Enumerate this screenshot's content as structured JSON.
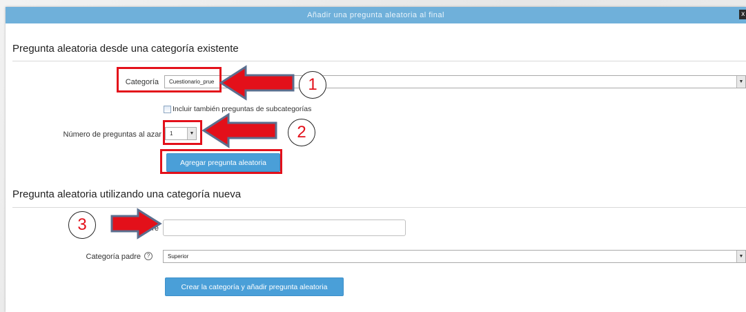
{
  "dialog": {
    "title": "Añadir una pregunta aleatoria al final",
    "close_label": "x"
  },
  "existing": {
    "heading": "Pregunta aleatoria desde una categoría existente",
    "category_label": "Categoría",
    "category_value": "Cuestionario_prue",
    "include_sub_label": "Incluir también preguntas de subcategorías",
    "include_sub_checked": false,
    "number_label": "Número de preguntas al azar",
    "number_value": "1",
    "add_button": "Agregar pregunta aleatoria"
  },
  "new_category": {
    "heading": "Pregunta aleatoria utilizando una categoría nueva",
    "name_label": "Nombre",
    "name_value": "",
    "parent_label": "Categoría padre",
    "parent_value": "Superior",
    "create_button": "Crear la categoría y añadir pregunta aleatoria"
  },
  "annotations": {
    "step1": "1",
    "step2": "2",
    "step3": "3",
    "color": "#e3101a"
  },
  "colors": {
    "titlebar": "#6fb0da",
    "button": "#4a9fd8"
  }
}
